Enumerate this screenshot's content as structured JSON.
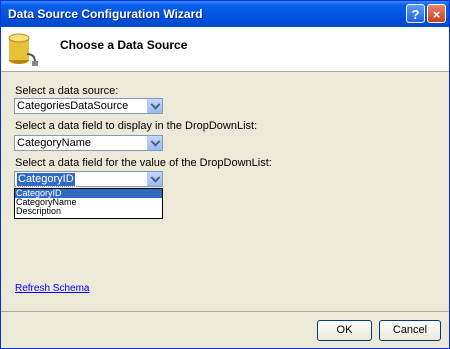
{
  "window": {
    "title": "Data Source Configuration Wizard",
    "help_label": "?",
    "close_label": "×"
  },
  "header": {
    "title": "Choose a Data Source",
    "icon": "database-icon"
  },
  "form": {
    "data_source": {
      "label": "Select a data source:",
      "value": "CategoriesDataSource"
    },
    "display_field": {
      "label": "Select a data field to display in the DropDownList:",
      "value": "CategoryName"
    },
    "value_field": {
      "label": "Select a data field for the value of the DropDownList:",
      "value": "CategoryID",
      "options": [
        "CategoryID",
        "CategoryName",
        "Description"
      ]
    },
    "refresh_link": "Refresh Schema"
  },
  "footer": {
    "ok_label": "OK",
    "cancel_label": "Cancel"
  },
  "colors": {
    "titlebar": "#0053e1",
    "selection": "#316ac5",
    "link": "#0000ff",
    "dialog": "#ece9d8"
  }
}
